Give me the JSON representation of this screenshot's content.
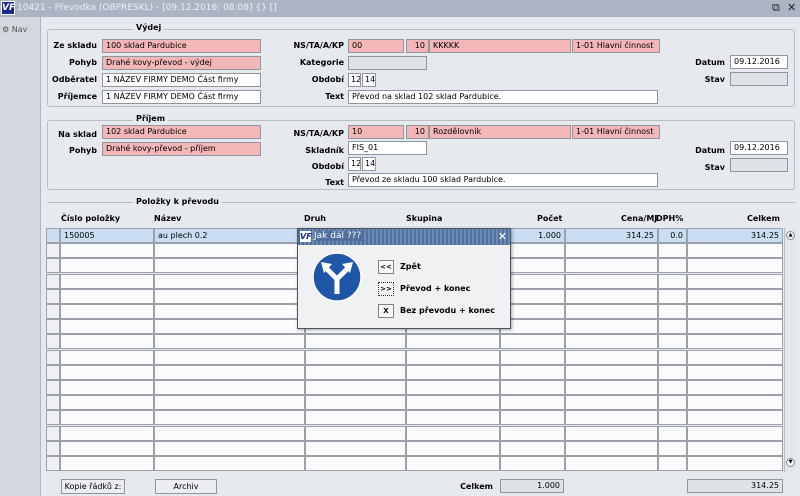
{
  "window": {
    "title": "10421 - Převodka (OBPRESKL) - [09.12.2016; 08:08] {} []",
    "logo": "VF",
    "restore_icon": "⧉",
    "close_icon": "✕"
  },
  "nav": {
    "label": "Nav"
  },
  "vydej": {
    "title": "Výdej",
    "ze_skladu_label": "Ze skladu",
    "ze_skladu_value": "100 sklad Pardubice",
    "pohyb_label": "Pohyb",
    "pohyb_value": "Drahé kovy-převod - výdej",
    "odberatel_label": "Odběratel",
    "odberatel_value": "1 NÁZEV FIRMY DEMO Část firmy",
    "prijemce_label": "Příjemce",
    "prijemce_value": "1 NÁZEV FIRMY DEMO Část firmy",
    "ns_label": "NS/TA/A/KP",
    "ns_1": "00",
    "ns_2": "10",
    "ns_3": "KKKKK",
    "ns_4": "1-01 Hlavní činnost",
    "kategorie_label": "Kategorie",
    "obdobi_label": "Období",
    "obdobi_1": "12",
    "obdobi_2": "14",
    "text_label": "Text",
    "text_value": "Převod na sklad 102 sklad Pardubice.",
    "datum_label": "Datum",
    "datum_value": "09.12.2016",
    "stav_label": "Stav"
  },
  "prijem": {
    "title": "Příjem",
    "na_sklad_label": "Na sklad",
    "na_sklad_value": "102 sklad Pardubice",
    "pohyb_label": "Pohyb",
    "pohyb_value": "Drahé kovy-převod - příjem",
    "ns_label": "NS/TA/A/KP",
    "ns_1": "10",
    "ns_2": "10",
    "ns_3": "Rozdělovník",
    "ns_4": "1-01 Hlavní činnost",
    "skladnik_label": "Skladník",
    "skladnik_value": "FIS_01",
    "obdobi_label": "Období",
    "obdobi_1": "12",
    "obdobi_2": "14",
    "text_label": "Text",
    "text_value": "Převod ze skladu 100 sklad Pardubice.",
    "datum_label": "Datum",
    "datum_value": "09.12.2016",
    "stav_label": "Stav"
  },
  "items": {
    "title": "Položky k převodu",
    "headers": {
      "cislo": "Číslo položky",
      "nazev": "Název",
      "druh": "Druh",
      "skupina": "Skupina",
      "pocet": "Počet",
      "cena": "Cena/MJ",
      "dph": "DPH%",
      "celkem": "Celkem"
    },
    "rows": [
      {
        "cislo": "150005",
        "nazev": "au plech 0.2",
        "druh": "",
        "skupina": "",
        "pocet": "1.000",
        "cena": "314.25",
        "dph": "0.0",
        "celkem": "314.25"
      }
    ],
    "empty_rows": 15
  },
  "footer": {
    "kopie_label": "Kopie řádků z:",
    "archiv_label": "Archiv",
    "celkem_label": "Celkem",
    "celkem_pocet": "1.000",
    "celkem_value": "314.25"
  },
  "dialog": {
    "logo": "VF",
    "title": "Jak dál ???",
    "close_icon": "✕",
    "options": [
      {
        "button": "<<",
        "label": "Zpět"
      },
      {
        "button": ">>",
        "label": "Převod + konec"
      },
      {
        "button": "X",
        "label": "Bez převodu + konec"
      }
    ]
  },
  "colors": {
    "pink_field": "#f4b7b7",
    "selected_row": "#c9ddf3",
    "dialog_title": "#4f6f9c",
    "road_sign": "#1f56a8"
  }
}
